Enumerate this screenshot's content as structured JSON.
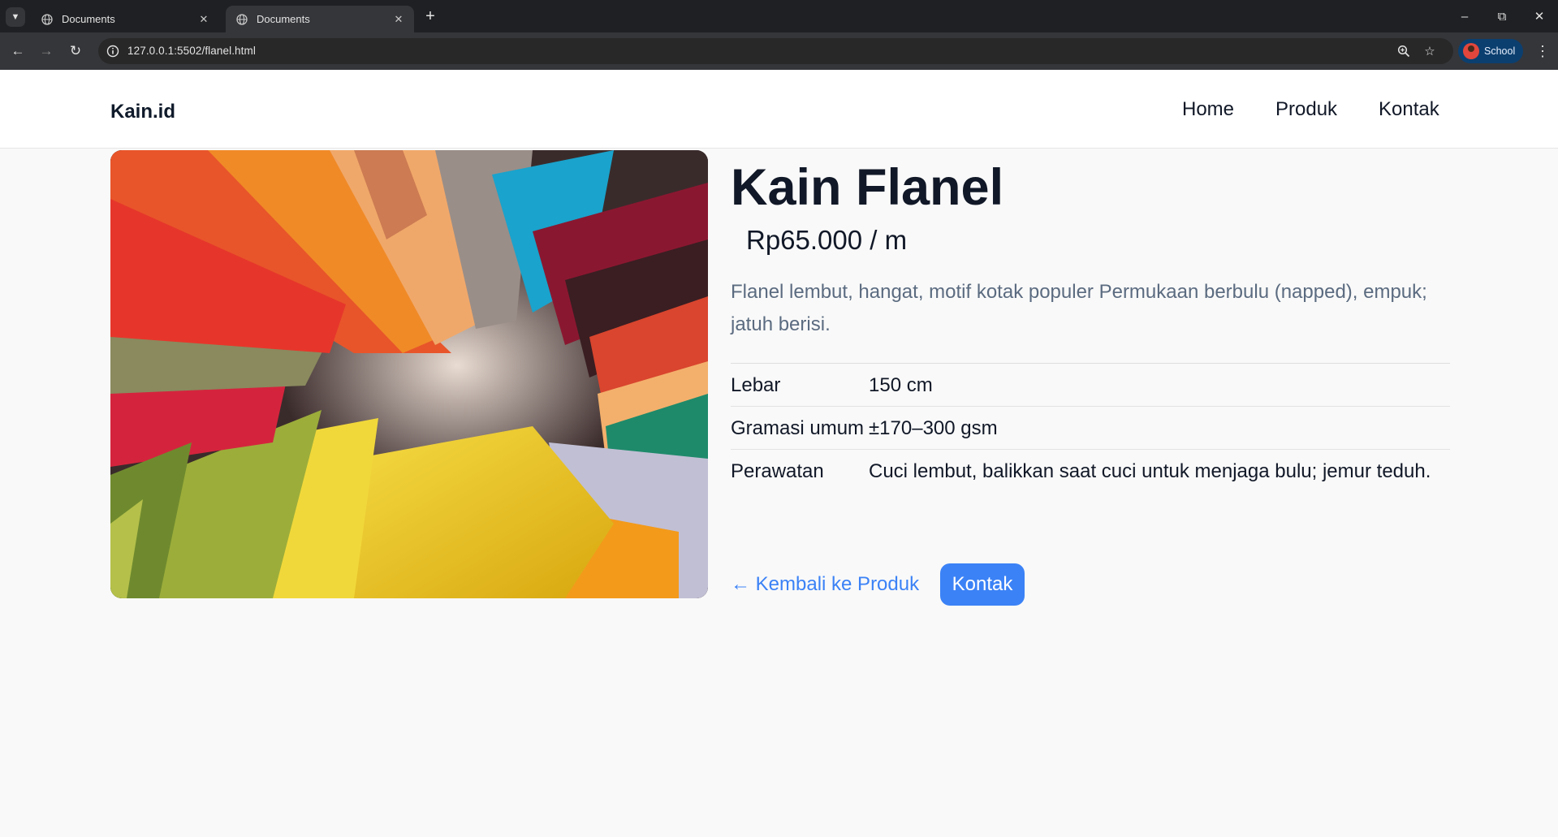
{
  "browser": {
    "tabs": [
      {
        "title": "Documents",
        "active": false
      },
      {
        "title": "Documents",
        "active": true
      }
    ],
    "url": "127.0.0.1:5502/flanel.html",
    "profile_label": "School"
  },
  "site": {
    "logo": "Kain.id",
    "nav": [
      {
        "label": "Home"
      },
      {
        "label": "Produk"
      },
      {
        "label": "Kontak"
      }
    ]
  },
  "product": {
    "title": "Kain Flanel",
    "price": "Rp65.000 / m",
    "description": "Flanel lembut, hangat, motif kotak populer Permukaan berbulu (napped), empuk; jatuh berisi.",
    "specs": [
      {
        "key": "Lebar",
        "value": "150 cm"
      },
      {
        "key": "Gramasi umum",
        "value": "±170–300 gsm"
      },
      {
        "key": "Perawatan",
        "value": "Cuci lembut, balikkan saat cuci untuk menjaga bulu; jemur teduh."
      }
    ],
    "back_link": "← Kembali ke Produk",
    "contact_button": "Kontak",
    "image_alt": "colorful felt fabric rolls"
  },
  "colors": {
    "accent": "#3b82f6",
    "text_dark": "#111827",
    "text_muted": "#5b6b80",
    "page_bg": "#f9f9f9"
  }
}
